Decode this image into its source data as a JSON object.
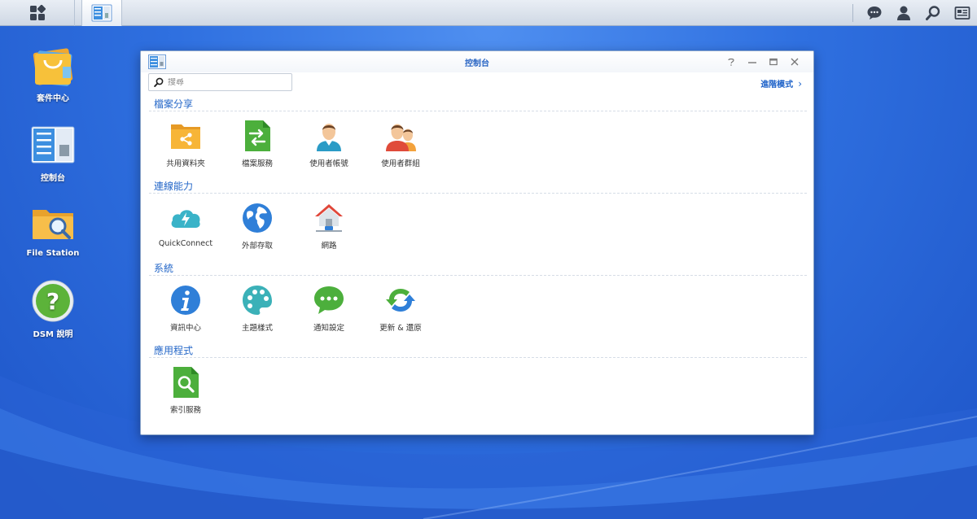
{
  "taskbar": {
    "main_menu_icon": "grid-icon",
    "open_app_icon": "control-panel-icon",
    "right_icons": [
      "chat-icon",
      "user-icon",
      "search-icon",
      "widgets-icon"
    ]
  },
  "desktop": {
    "icons": [
      {
        "label": "套件中心",
        "icon": "package-center-icon"
      },
      {
        "label": "控制台",
        "icon": "control-panel-icon"
      },
      {
        "label": "File Station",
        "icon": "file-station-icon"
      },
      {
        "label": "DSM 說明",
        "icon": "help-icon"
      }
    ]
  },
  "window": {
    "title": "控制台",
    "controls": [
      "help",
      "minimize",
      "maximize",
      "close"
    ],
    "search_placeholder": "搜尋",
    "advanced_mode": "進階模式",
    "sections": [
      {
        "title": "檔案分享",
        "items": [
          {
            "label": "共用資料夾",
            "icon": "shared-folder-icon"
          },
          {
            "label": "檔案服務",
            "icon": "file-services-icon"
          },
          {
            "label": "使用者帳號",
            "icon": "user-icon"
          },
          {
            "label": "使用者群組",
            "icon": "group-icon"
          }
        ]
      },
      {
        "title": "連線能力",
        "items": [
          {
            "label": "QuickConnect",
            "icon": "quickconnect-icon"
          },
          {
            "label": "外部存取",
            "icon": "globe-icon"
          },
          {
            "label": "網路",
            "icon": "network-icon"
          }
        ]
      },
      {
        "title": "系統",
        "items": [
          {
            "label": "資訊中心",
            "icon": "info-icon"
          },
          {
            "label": "主題樣式",
            "icon": "palette-icon"
          },
          {
            "label": "通知設定",
            "icon": "notification-icon"
          },
          {
            "label": "更新 & 還原",
            "icon": "update-icon"
          }
        ]
      },
      {
        "title": "應用程式",
        "items": [
          {
            "label": "索引服務",
            "icon": "indexing-icon"
          }
        ]
      }
    ]
  },
  "colors": {
    "accent": "#2467c8",
    "desktop": "#2f70e0",
    "taskbar": "#dde4ee"
  }
}
